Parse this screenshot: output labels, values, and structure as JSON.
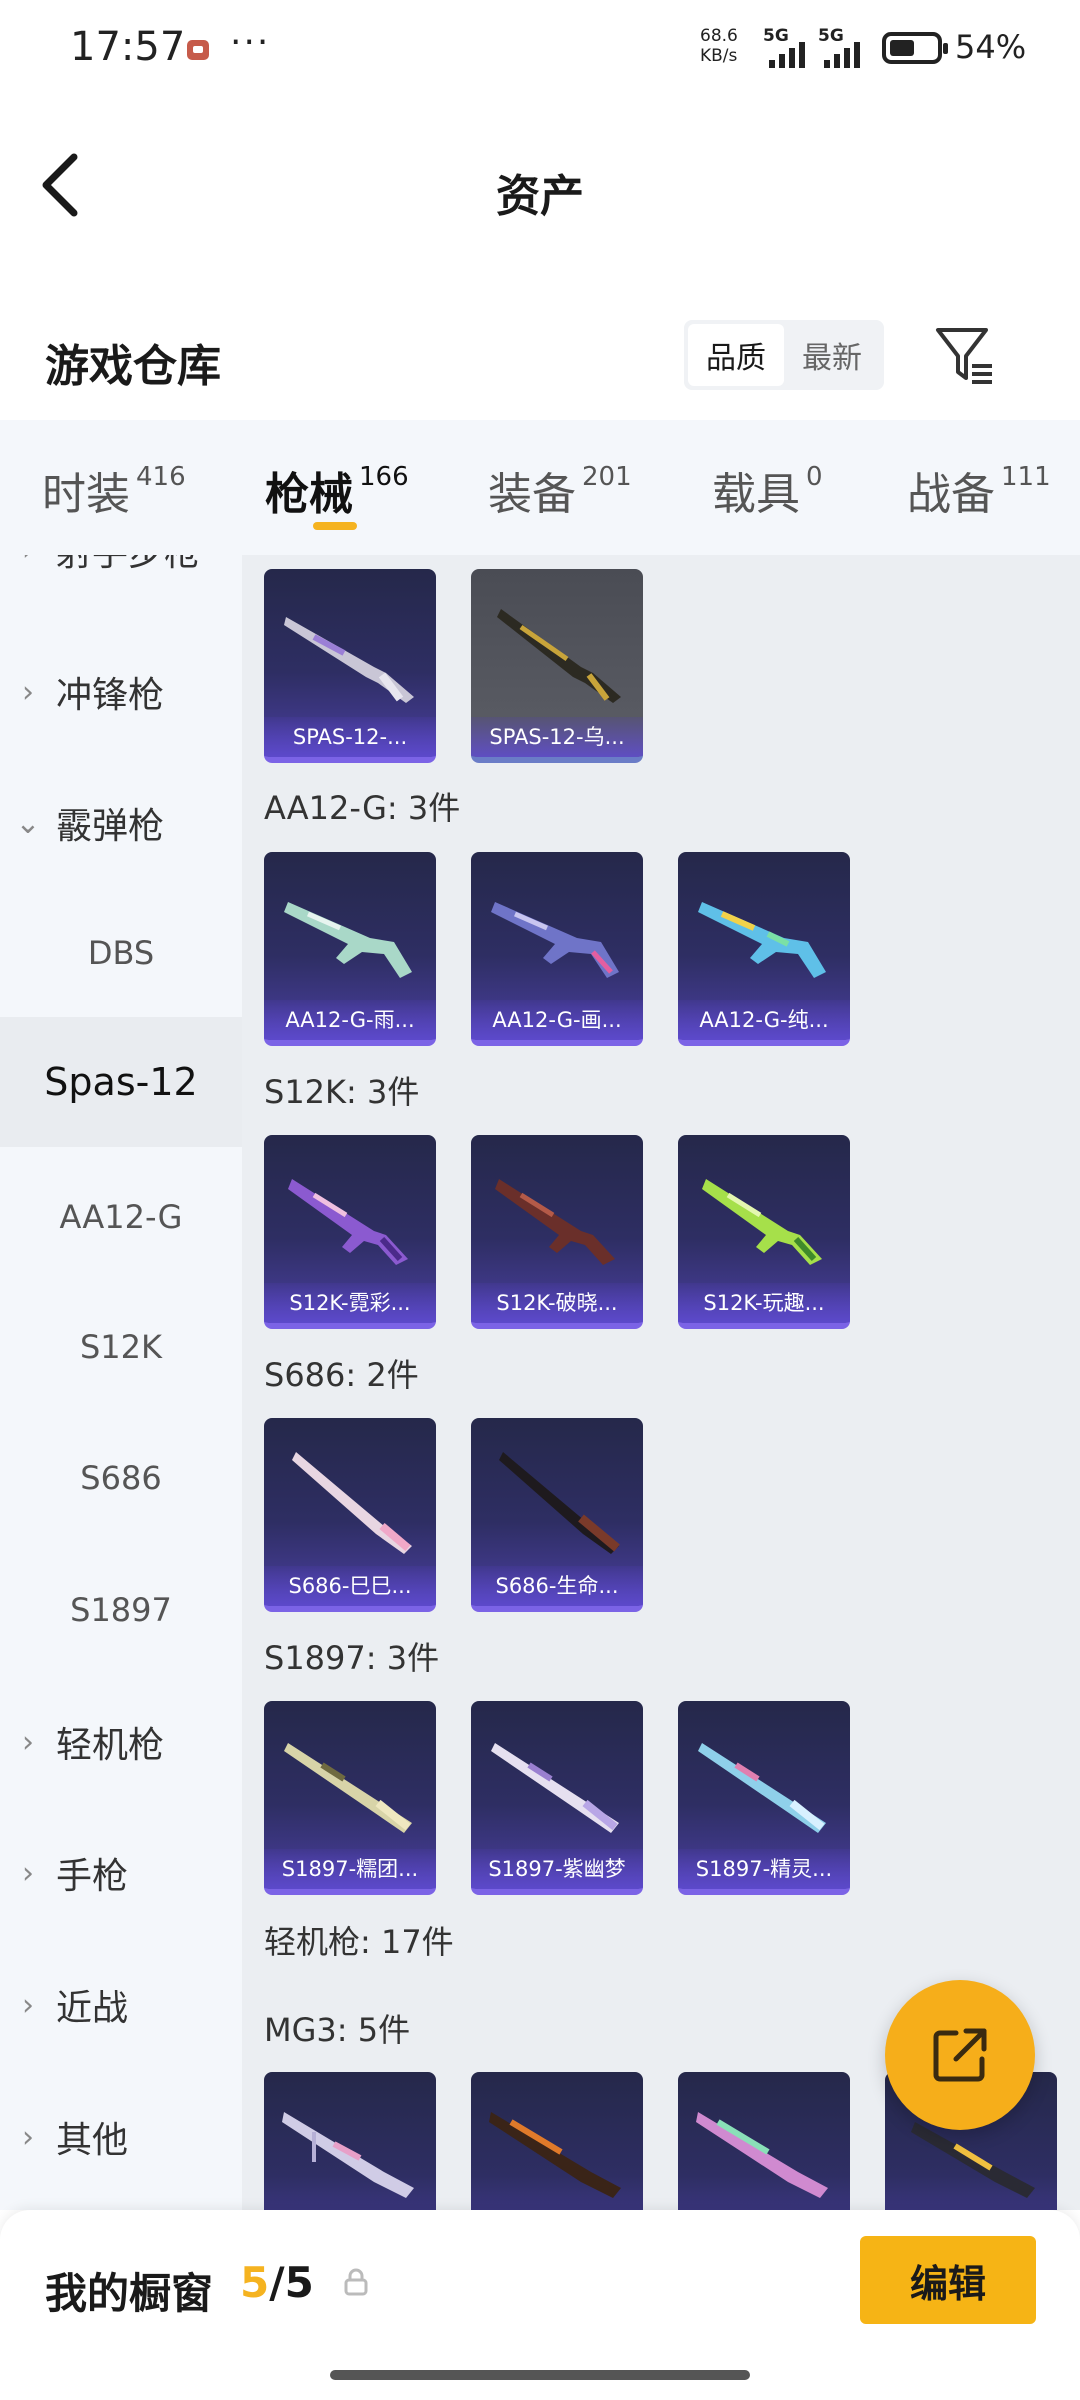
{
  "status_bar": {
    "time": "17:57",
    "dots": "···",
    "net_speed_value": "68.6",
    "net_speed_unit": "KB/s",
    "signal1": "5G",
    "signal2": "5G",
    "battery": "54%"
  },
  "nav": {
    "title": "资产"
  },
  "header": {
    "title": "游戏仓库",
    "sort_options": [
      "品质",
      "最新"
    ],
    "sort_selected": "品质"
  },
  "tabs": [
    {
      "label": "时装",
      "count": "416"
    },
    {
      "label": "枪械",
      "count": "166"
    },
    {
      "label": "装备",
      "count": "201"
    },
    {
      "label": "载具",
      "count": "0"
    },
    {
      "label": "战备",
      "count": "111"
    }
  ],
  "sidebar": {
    "items": [
      {
        "label": "射手步枪"
      },
      {
        "label": "冲锋枪"
      },
      {
        "label": "霰弹枪"
      },
      {
        "label": "DBS"
      },
      {
        "label": "Spas-12"
      },
      {
        "label": "AA12-G"
      },
      {
        "label": "S12K"
      },
      {
        "label": "S686"
      },
      {
        "label": "S1897"
      },
      {
        "label": "轻机枪"
      },
      {
        "label": "手枪"
      },
      {
        "label": "近战"
      },
      {
        "label": "其他"
      }
    ]
  },
  "groups": [
    {
      "label": "",
      "items": [
        "SPAS-12-...",
        "SPAS-12-乌..."
      ]
    },
    {
      "label": "AA12-G: 3件",
      "items": [
        "AA12-G-雨...",
        "AA12-G-画...",
        "AA12-G-纯..."
      ]
    },
    {
      "label": "S12K: 3件",
      "items": [
        "S12K-霓彩...",
        "S12K-破晓...",
        "S12K-玩趣..."
      ]
    },
    {
      "label": "S686: 2件",
      "items": [
        "S686-巳巳...",
        "S686-生命..."
      ]
    },
    {
      "label": "S1897: 3件",
      "items": [
        "S1897-糯团...",
        "S1897-紫幽梦",
        "S1897-精灵..."
      ]
    },
    {
      "label": "轻机枪: 17件"
    },
    {
      "label": "MG3: 5件"
    }
  ],
  "bottom": {
    "showcase_label": "我的橱窗",
    "showcase_current": "5",
    "showcase_sep": "/",
    "showcase_max": "5",
    "edit_label": "编辑"
  },
  "colors": {
    "accent": "#f5b320",
    "card_bottom": "#7b63e6"
  }
}
